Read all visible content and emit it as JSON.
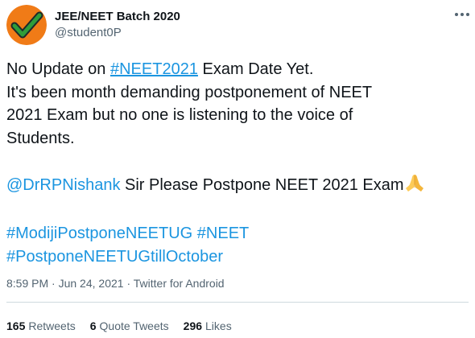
{
  "user": {
    "display_name": "JEE/NEET Batch 2020",
    "handle": "@student0P",
    "avatar_icon": "orange-green-checkmark-avatar"
  },
  "tweet": {
    "line1_prefix": "No Update on ",
    "line1_hashtag": "#NEET2021",
    "line1_suffix": " Exam Date Yet.",
    "line2": "It's been month demanding postponement of NEET",
    "line3": "2021 Exam but no one is listening to the voice of",
    "line4": "Students.",
    "mention": "@DrRPNishank",
    "mention_suffix": " Sir Please Postpone NEET 2021 Exam",
    "emoji_icon": "folded-hands-emoji",
    "hashtag1": "#ModijiPostponeNEETUG",
    "hashtag2": "#NEET",
    "hashtag3": "#PostponeNEETUGtillOctober"
  },
  "meta": {
    "time": "8:59 PM",
    "sep": " · ",
    "date": "Jun 24, 2021",
    "sep2": " · ",
    "source": "Twitter for Android"
  },
  "stats": {
    "retweets_count": "165",
    "retweets_label": "Retweets",
    "quotes_count": "6",
    "quotes_label": "Quote Tweets",
    "likes_count": "296",
    "likes_label": "Likes"
  },
  "colors": {
    "link": "#1b95e0",
    "text": "#0f1419",
    "muted": "#536471",
    "avatar_orange": "#f07b17",
    "avatar_green": "#2f9d3a"
  }
}
